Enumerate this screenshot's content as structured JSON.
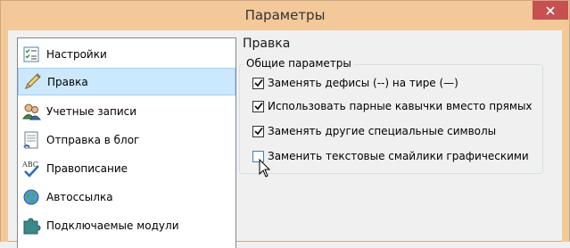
{
  "window": {
    "title": "Параметры"
  },
  "sidebar": {
    "items": [
      {
        "label": "Настройки",
        "icon": "settings-list-icon",
        "selected": false
      },
      {
        "label": "Правка",
        "icon": "pencil-icon",
        "selected": true
      },
      {
        "label": "Учетные записи",
        "icon": "users-icon",
        "selected": false
      },
      {
        "label": "Отправка в блог",
        "icon": "blog-post-icon",
        "selected": false
      },
      {
        "label": "Правописание",
        "icon": "spellcheck-icon",
        "selected": false
      },
      {
        "label": "Автоссылка",
        "icon": "globe-link-icon",
        "selected": false
      },
      {
        "label": "Подключаемые модули",
        "icon": "puzzle-plugin-icon",
        "selected": false
      }
    ]
  },
  "main": {
    "section_title": "Правка",
    "group_label": "Общие параметры",
    "options": [
      {
        "label": "Заменять дефисы (--) на тире (—)",
        "checked": true
      },
      {
        "label": "Использовать парные кавычки вместо прямых",
        "checked": true
      },
      {
        "label": "Заменять другие специальные символы",
        "checked": true
      },
      {
        "label": "Заменить текстовые смайлики графическими",
        "checked": false
      }
    ]
  },
  "colors": {
    "titlebar": "#f3c99a",
    "close_button": "#c75050",
    "selection": "#cce8ff"
  }
}
